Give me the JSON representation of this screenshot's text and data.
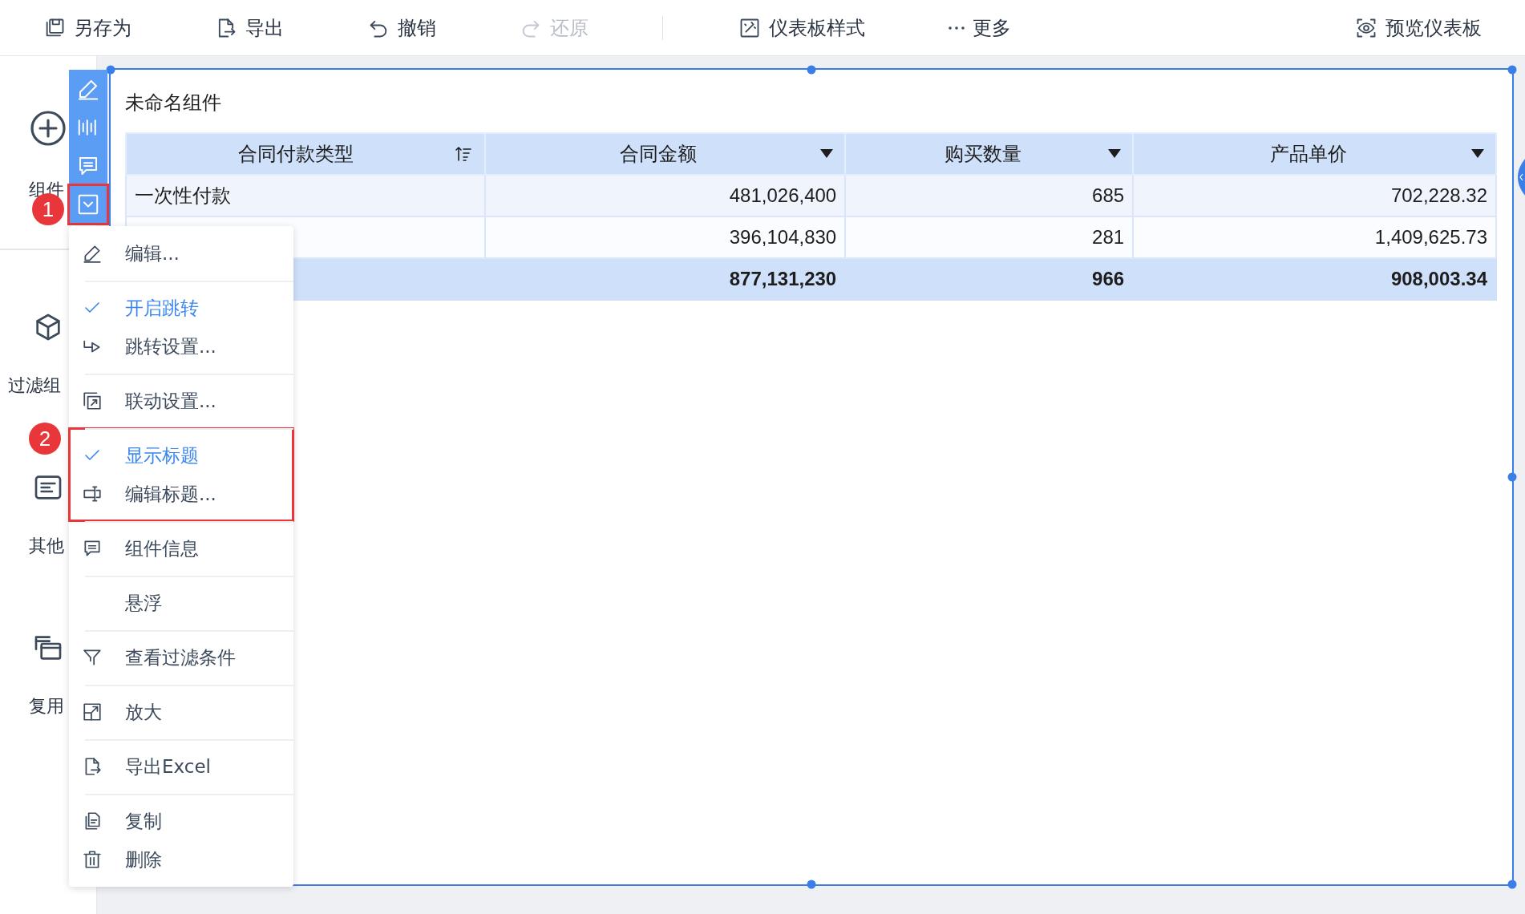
{
  "toolbar": {
    "items": [
      {
        "label": "另存为",
        "disabled": false
      },
      {
        "label": "导出",
        "disabled": false
      },
      {
        "label": "撤销",
        "disabled": false
      },
      {
        "label": "还原",
        "disabled": true
      },
      {
        "label": "仪表板样式",
        "disabled": false
      },
      {
        "label": "更多",
        "disabled": false
      }
    ],
    "preview": "预览仪表板"
  },
  "sidebar": {
    "items": [
      {
        "label": "组件"
      },
      {
        "label": "过滤组"
      },
      {
        "label": "其他"
      },
      {
        "label": "复用"
      }
    ]
  },
  "widget": {
    "title": "未命名组件",
    "table": {
      "columns": [
        {
          "label": "合同付款类型",
          "kind": "sort"
        },
        {
          "label": "合同金额",
          "kind": "dropdown"
        },
        {
          "label": "购买数量",
          "kind": "dropdown"
        },
        {
          "label": "产品单价",
          "kind": "dropdown"
        }
      ],
      "rows": [
        {
          "kind": "data",
          "cells": [
            "一次性付款",
            "481,026,400",
            "685",
            "702,228.32"
          ]
        },
        {
          "kind": "data",
          "cells": [
            null,
            "396,104,830",
            "281",
            "1,409,625.73"
          ]
        },
        {
          "kind": "total",
          "cells": [
            null,
            "877,131,230",
            "966",
            "908,003.34"
          ]
        }
      ]
    }
  },
  "widget_toolbar": {
    "buttons": [
      {
        "highlighted": false
      },
      {
        "highlighted": false
      },
      {
        "highlighted": false
      },
      {
        "highlighted": true,
        "badge": "1"
      }
    ]
  },
  "context_menu": {
    "groups": [
      {
        "highlighted": false,
        "items": [
          {
            "kind": "action",
            "label": "编辑..."
          }
        ]
      },
      {
        "highlighted": false,
        "items": [
          {
            "kind": "toggle",
            "label": "开启跳转",
            "checked": true
          },
          {
            "kind": "action",
            "label": "跳转设置..."
          }
        ]
      },
      {
        "highlighted": false,
        "items": [
          {
            "kind": "action",
            "label": "联动设置..."
          }
        ]
      },
      {
        "highlighted": true,
        "badge": "2",
        "items": [
          {
            "kind": "toggle",
            "label": "显示标题",
            "checked": true
          },
          {
            "kind": "action",
            "label": "编辑标题..."
          }
        ]
      },
      {
        "highlighted": false,
        "items": [
          {
            "kind": "action",
            "label": "组件信息"
          }
        ]
      },
      {
        "highlighted": false,
        "items": [
          {
            "kind": "toggle",
            "label": "悬浮",
            "checked": false
          }
        ]
      },
      {
        "highlighted": false,
        "items": [
          {
            "kind": "action",
            "label": "查看过滤条件"
          }
        ]
      },
      {
        "highlighted": false,
        "items": [
          {
            "kind": "action",
            "label": "放大"
          }
        ]
      },
      {
        "highlighted": false,
        "items": [
          {
            "kind": "action",
            "label": "导出Excel"
          }
        ]
      },
      {
        "highlighted": false,
        "items": [
          {
            "kind": "action",
            "label": "复制"
          },
          {
            "kind": "action",
            "label": "删除"
          }
        ]
      }
    ]
  }
}
